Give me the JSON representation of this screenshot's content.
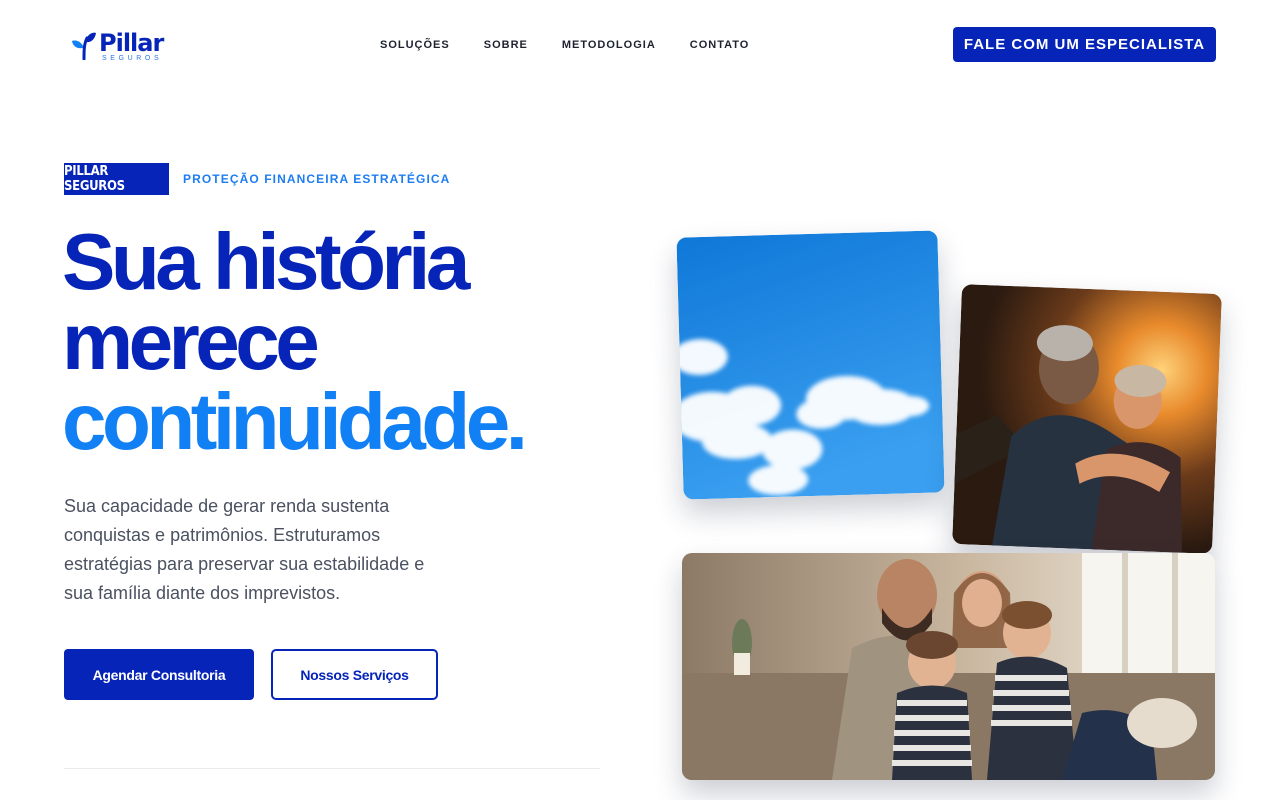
{
  "brand": {
    "name": "Pillar",
    "subtitle": "SEGUROS",
    "icon": "leaf-logo-icon",
    "primary_color": "#0624b8",
    "accent_color": "#1180f5"
  },
  "nav": {
    "items": [
      {
        "label": "SOLUÇÕES"
      },
      {
        "label": "SOBRE"
      },
      {
        "label": "METODOLOGIA"
      },
      {
        "label": "CONTATO"
      }
    ],
    "cta_label": "FALE COM UM ESPECIALISTA"
  },
  "hero": {
    "badge": "PILLAR SEGUROS",
    "eyebrow": "PROTEÇÃO FINANCEIRA ESTRATÉGICA",
    "headline": {
      "line1": "Sua história",
      "line2": "merece",
      "line3": "continuidade."
    },
    "lead": "Sua capacidade de gerar renda sustenta conquistas e patrimônios. Estruturamos estratégias para preservar sua estabilidade e sua família diante dos imprevistos.",
    "primary_button": "Agendar Consultoria",
    "secondary_button": "Nossos Serviços"
  },
  "gallery": {
    "images": [
      {
        "subject": "blue sky with clouds"
      },
      {
        "subject": "elderly couple embracing at sunset"
      },
      {
        "subject": "smiling family on sofa"
      }
    ]
  }
}
